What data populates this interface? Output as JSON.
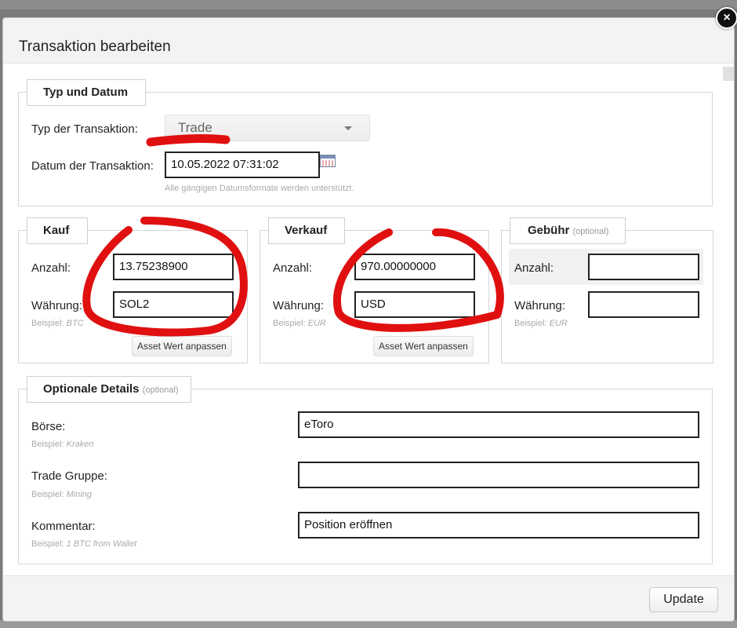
{
  "modal": {
    "title": "Transaktion bearbeiten",
    "close_label": "×"
  },
  "typ_datum": {
    "legend": "Typ und Datum",
    "type_label": "Typ der Transaktion:",
    "type_value": "Trade",
    "date_label": "Datum der Transaktion:",
    "date_value": "10.05.2022 07:31:02",
    "date_hint": "Alle gängigen Datumsformate werden unterstützt."
  },
  "kauf": {
    "legend": "Kauf",
    "amount_label": "Anzahl:",
    "amount_value": "13.75238900",
    "currency_label": "Währung:",
    "currency_value": "SOL2",
    "hint_prefix": "Beispiel: ",
    "hint_example": "BTC",
    "asset_button": "Asset Wert anpassen"
  },
  "verkauf": {
    "legend": "Verkauf",
    "amount_label": "Anzahl:",
    "amount_value": "970.00000000",
    "currency_label": "Währung:",
    "currency_value": "USD",
    "hint_prefix": "Beispiel: ",
    "hint_example": "EUR",
    "asset_button": "Asset Wert anpassen"
  },
  "gebuehr": {
    "legend": "Gebühr",
    "legend_optional": "(optional)",
    "amount_label": "Anzahl:",
    "amount_value": "",
    "currency_label": "Währung:",
    "currency_value": "",
    "hint_prefix": "Beispiel: ",
    "hint_example": "EUR"
  },
  "optionale_details": {
    "legend": "Optionale Details",
    "legend_optional": "(optional)",
    "exchange_label": "Börse:",
    "exchange_hint_prefix": "Beispiel: ",
    "exchange_hint_example": "Kraken",
    "exchange_value": "eToro",
    "group_label": "Trade Gruppe:",
    "group_hint_prefix": "Beispiel: ",
    "group_hint_example": "Mining",
    "group_value": "",
    "comment_label": "Kommentar:",
    "comment_hint_prefix": "Beispiel: ",
    "comment_hint_example": "1 BTC from Wallet",
    "comment_value": "Position eröffnen"
  },
  "footer": {
    "update_button": "Update"
  },
  "colors": {
    "annotation": "#e01010",
    "header_bg": "#f3f3f3",
    "close_bg": "#111111"
  }
}
